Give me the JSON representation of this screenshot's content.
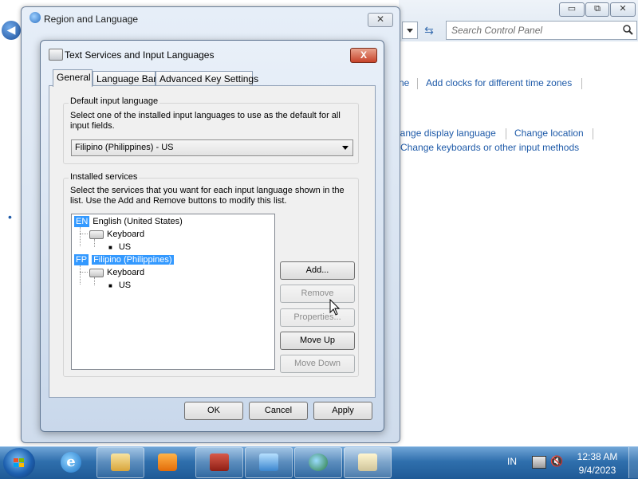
{
  "control_panel": {
    "search_placeholder": "Search Control Panel",
    "window_buttons": {
      "minimize": "▭",
      "maximize": "⧉",
      "close": "✕"
    },
    "links": {
      "ne": "ne",
      "add_clocks": "Add clocks for different time zones",
      "change_display_language": "hange display language",
      "change_location": "Change location",
      "change_keyboards": "Change keyboards or other input methods"
    },
    "bullet": "•"
  },
  "region_window": {
    "title": "Region and Language",
    "close": "✕",
    "back_arrow": "◀"
  },
  "dialog": {
    "title": "Text Services and Input Languages",
    "close": "X",
    "tabs": [
      "General",
      "Language Bar",
      "Advanced Key Settings"
    ],
    "default_input": {
      "group_label": "Default input language",
      "description": "Select one of the installed input languages to use as the default for all input fields.",
      "selected": "Filipino (Philippines) - US"
    },
    "installed_services": {
      "group_label": "Installed services",
      "description": "Select the services that you want for each input language shown in the list. Use the Add and Remove buttons to modify this list.",
      "languages": [
        {
          "badge": "EN",
          "name": "English (United States)",
          "category": "Keyboard",
          "layout": "US"
        },
        {
          "badge": "FP",
          "name": "Filipino (Philippines)",
          "category": "Keyboard",
          "layout": "US",
          "selected": true
        }
      ],
      "buttons": {
        "add": "Add...",
        "remove": "Remove",
        "properties": "Properties...",
        "move_up": "Move Up",
        "move_down": "Move Down"
      }
    },
    "footer": {
      "ok": "OK",
      "cancel": "Cancel",
      "apply": "Apply"
    }
  },
  "taskbar": {
    "language": "IN",
    "time": "12:38 AM",
    "date": "9/4/2023"
  },
  "colors": {
    "accent": "#3399ff",
    "link": "#1e5aa8",
    "close_red": "#c7432a"
  }
}
